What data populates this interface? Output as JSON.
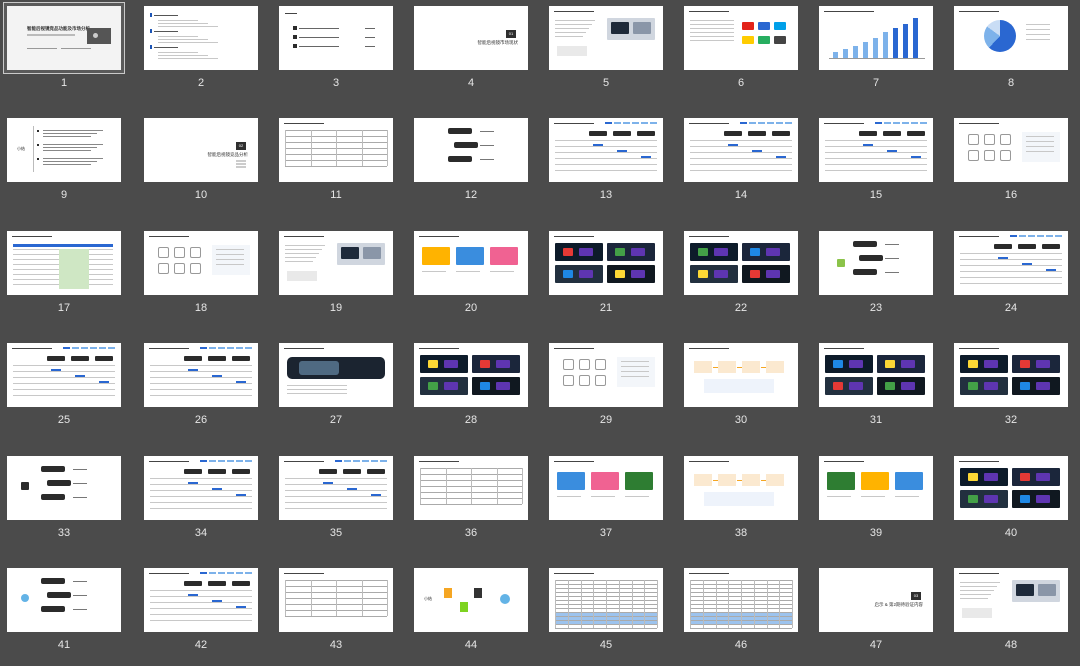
{
  "window": {
    "background": "#4b4b4b",
    "selected_slide": 1
  },
  "slides": [
    {
      "n": "1",
      "kind": "cover",
      "title": "智能后视镜竞品功能及市场分析"
    },
    {
      "n": "2",
      "kind": "agenda"
    },
    {
      "n": "3",
      "kind": "toc"
    },
    {
      "n": "4",
      "kind": "section",
      "badge": "01",
      "title": "智能后视镜市场现状"
    },
    {
      "n": "5",
      "kind": "text-image"
    },
    {
      "n": "6",
      "kind": "text-logos"
    },
    {
      "n": "7",
      "kind": "barchart"
    },
    {
      "n": "8",
      "kind": "pie"
    },
    {
      "n": "9",
      "kind": "summary",
      "title": "小结"
    },
    {
      "n": "10",
      "kind": "section",
      "badge": "02",
      "title": "智能后视镜竞品分析"
    },
    {
      "n": "11",
      "kind": "table"
    },
    {
      "n": "12",
      "kind": "products"
    },
    {
      "n": "13",
      "kind": "compare"
    },
    {
      "n": "14",
      "kind": "compare"
    },
    {
      "n": "15",
      "kind": "compare"
    },
    {
      "n": "16",
      "kind": "icons"
    },
    {
      "n": "17",
      "kind": "table-blue"
    },
    {
      "n": "18",
      "kind": "icons"
    },
    {
      "n": "19",
      "kind": "text-image"
    },
    {
      "n": "20",
      "kind": "screens"
    },
    {
      "n": "21",
      "kind": "dark-screens"
    },
    {
      "n": "22",
      "kind": "dark-screens"
    },
    {
      "n": "23",
      "kind": "products"
    },
    {
      "n": "24",
      "kind": "compare"
    },
    {
      "n": "25",
      "kind": "compare"
    },
    {
      "n": "26",
      "kind": "compare"
    },
    {
      "n": "27",
      "kind": "mirror-photo"
    },
    {
      "n": "28",
      "kind": "dark-screens"
    },
    {
      "n": "29",
      "kind": "icons"
    },
    {
      "n": "30",
      "kind": "flow"
    },
    {
      "n": "31",
      "kind": "dark-screens"
    },
    {
      "n": "32",
      "kind": "dark-screens"
    },
    {
      "n": "33",
      "kind": "products"
    },
    {
      "n": "34",
      "kind": "compare"
    },
    {
      "n": "35",
      "kind": "compare"
    },
    {
      "n": "36",
      "kind": "table"
    },
    {
      "n": "37",
      "kind": "screens"
    },
    {
      "n": "38",
      "kind": "flow"
    },
    {
      "n": "39",
      "kind": "screens"
    },
    {
      "n": "40",
      "kind": "dark-screens"
    },
    {
      "n": "41",
      "kind": "products"
    },
    {
      "n": "42",
      "kind": "compare"
    },
    {
      "n": "43",
      "kind": "table"
    },
    {
      "n": "44",
      "kind": "summary",
      "title": "小结"
    },
    {
      "n": "45",
      "kind": "big-table"
    },
    {
      "n": "46",
      "kind": "big-table"
    },
    {
      "n": "47",
      "kind": "section",
      "badge": "03",
      "title": "启示 & 第2期待验证内容"
    },
    {
      "n": "48",
      "kind": "text-image"
    }
  ]
}
